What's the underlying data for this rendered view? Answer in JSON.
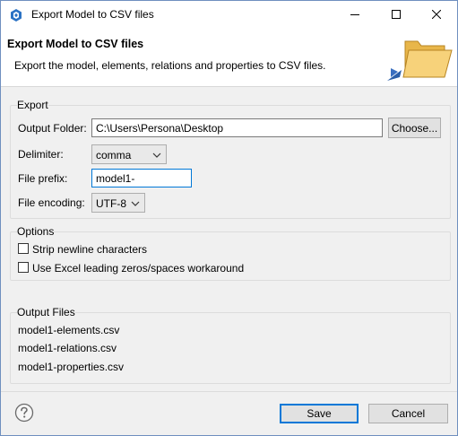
{
  "window": {
    "title": "Export Model to CSV files",
    "icons": {
      "app": "archi-app-icon",
      "minimize": "minimize-icon",
      "maximize": "maximize-icon",
      "close": "close-icon"
    }
  },
  "header": {
    "title": "Export Model to CSV files",
    "description": "Export the model, elements, relations and properties to CSV files.",
    "banner_icon": "folder-icon"
  },
  "export_group": {
    "label": "Export",
    "output_folder": {
      "label": "Output Folder:",
      "value": "C:\\Users\\Persona\\Desktop",
      "button": "Choose..."
    },
    "delimiter": {
      "label": "Delimiter:",
      "value": "comma"
    },
    "file_prefix": {
      "label": "File prefix:",
      "value": "model1-"
    },
    "file_encoding": {
      "label": "File encoding:",
      "value": "UTF-8"
    }
  },
  "options_group": {
    "label": "Options",
    "strip_newline": {
      "label": "Strip newline characters",
      "checked": false
    },
    "excel_workaround": {
      "label": "Use Excel leading zeros/spaces workaround",
      "checked": false
    }
  },
  "output_files": {
    "label": "Output Files",
    "items": [
      "model1-elements.csv",
      "model1-relations.csv",
      "model1-properties.csv"
    ]
  },
  "footer": {
    "help_icon": "help-icon",
    "save": "Save",
    "cancel": "Cancel"
  },
  "colors": {
    "accent": "#0078d7",
    "dialog_bg": "#f0f0f0",
    "border": "#6f8fbf"
  }
}
